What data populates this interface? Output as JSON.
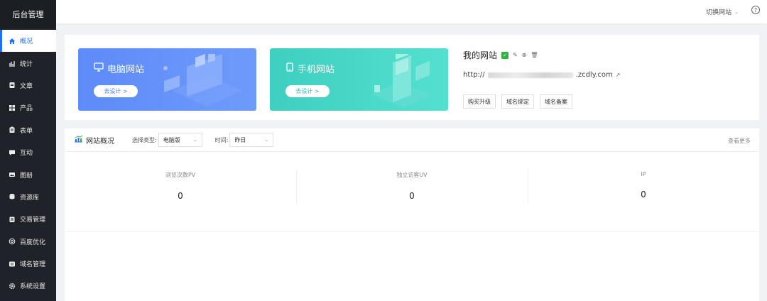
{
  "sidebar": {
    "brand": "后台管理",
    "items": [
      {
        "label": "概况",
        "icon": "home-icon",
        "active": true
      },
      {
        "label": "统计",
        "icon": "chart-icon"
      },
      {
        "label": "文章",
        "icon": "article-icon"
      },
      {
        "label": "产品",
        "icon": "grid-icon"
      },
      {
        "label": "表单",
        "icon": "form-icon"
      },
      {
        "label": "互动",
        "icon": "chat-icon"
      },
      {
        "label": "图册",
        "icon": "image-icon"
      },
      {
        "label": "资源库",
        "icon": "database-icon"
      },
      {
        "label": "交易管理",
        "icon": "trade-icon"
      },
      {
        "label": "百度优化",
        "icon": "seo-icon"
      },
      {
        "label": "域名管理",
        "icon": "domain-icon"
      },
      {
        "label": "系统设置",
        "icon": "gear-icon"
      }
    ]
  },
  "topbar": {
    "switch_site": "切换网站",
    "help": "?"
  },
  "banners": {
    "pc": {
      "title": "电脑网站",
      "button": "去设计 >"
    },
    "mobile": {
      "title": "手机网站",
      "button": "去设计 >"
    }
  },
  "site": {
    "name": "我的网站",
    "url_prefix": "http://",
    "url_suffix": ".zcdly.com",
    "actions": [
      "购买升级",
      "域名绑定",
      "域名备案"
    ]
  },
  "overview": {
    "title": "网站概况",
    "type_label": "选择类型:",
    "type_value": "电脑版",
    "time_label": "时间:",
    "time_value": "昨日",
    "view_more": "查看更多",
    "stats": [
      {
        "label": "浏览次数PV",
        "value": "0"
      },
      {
        "label": "独立访客UV",
        "value": "0"
      },
      {
        "label": "IP",
        "value": "0"
      }
    ]
  },
  "colors": {
    "accent": "#1e6fff",
    "sidebar_bg": "#1f2329",
    "pc_banner": "#5d8bf8",
    "mobile_banner": "#3ecfc0"
  }
}
